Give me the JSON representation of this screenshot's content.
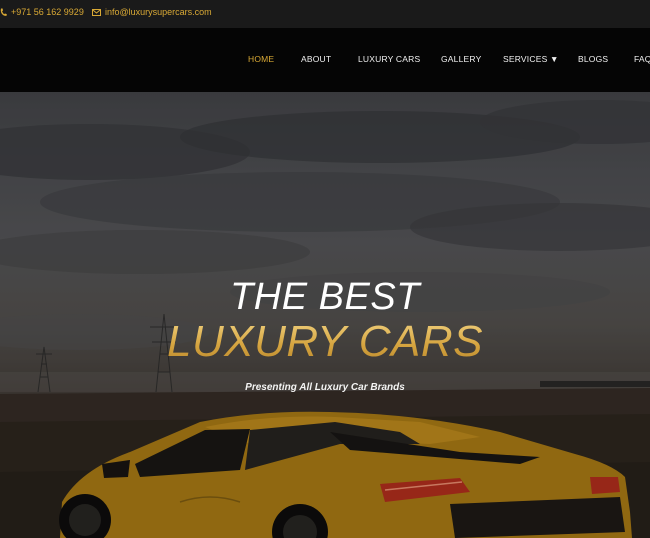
{
  "topbar": {
    "phone": "+971 56 162 9929",
    "email": "info@luxurysupercars.com"
  },
  "nav": {
    "items": [
      "HOME",
      "ABOUT",
      "LUXURY CARS",
      "GALLERY",
      "SERVICES ▼",
      "BLOGS",
      "FAQ"
    ],
    "active": "HOME"
  },
  "hero": {
    "line1": "THE BEST",
    "line2": "LUXURY CARS",
    "subtitle": "Presenting All Luxury Car Brands"
  },
  "colors": {
    "accent": "#d9a935",
    "nav_bg": "#050505",
    "topbar_bg": "#1a1a1a"
  },
  "icons": {
    "phone": "phone-icon",
    "email": "envelope-icon",
    "dropdown": "caret-down-icon"
  }
}
